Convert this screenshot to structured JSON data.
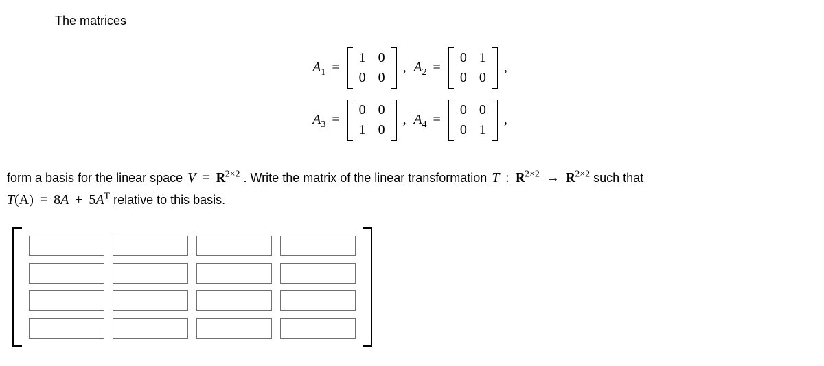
{
  "intro": "The matrices",
  "matrices": {
    "A1": {
      "label": "A",
      "sub": "1",
      "cells": [
        "1",
        "0",
        "0",
        "0"
      ]
    },
    "A2": {
      "label": "A",
      "sub": "2",
      "cells": [
        "0",
        "1",
        "0",
        "0"
      ]
    },
    "A3": {
      "label": "A",
      "sub": "3",
      "cells": [
        "0",
        "0",
        "1",
        "0"
      ]
    },
    "A4": {
      "label": "A",
      "sub": "4",
      "cells": [
        "0",
        "0",
        "0",
        "1"
      ]
    }
  },
  "problem": {
    "p1": "form a basis for the linear space ",
    "V": "V",
    "eq1": " = ",
    "R": "R",
    "dim": "2×2",
    "p2": ". Write the matrix of the linear transformation ",
    "T": "T",
    "colon": " : ",
    "arrow": " → ",
    "p3": " such that",
    "line2a": "T",
    "line2paren": "(A)",
    "line2eq": " = ",
    "line2expr1": "8",
    "line2A1": "A",
    "line2plus": " + ",
    "line2expr2": "5",
    "line2A2": "A",
    "line2Tsup": "T",
    "line2rel": " relative to this basis."
  },
  "answer": {
    "rows": 4,
    "cols": 4,
    "values": [
      [
        "",
        "",
        "",
        ""
      ],
      [
        "",
        "",
        "",
        ""
      ],
      [
        "",
        "",
        "",
        ""
      ],
      [
        "",
        "",
        "",
        ""
      ]
    ]
  }
}
